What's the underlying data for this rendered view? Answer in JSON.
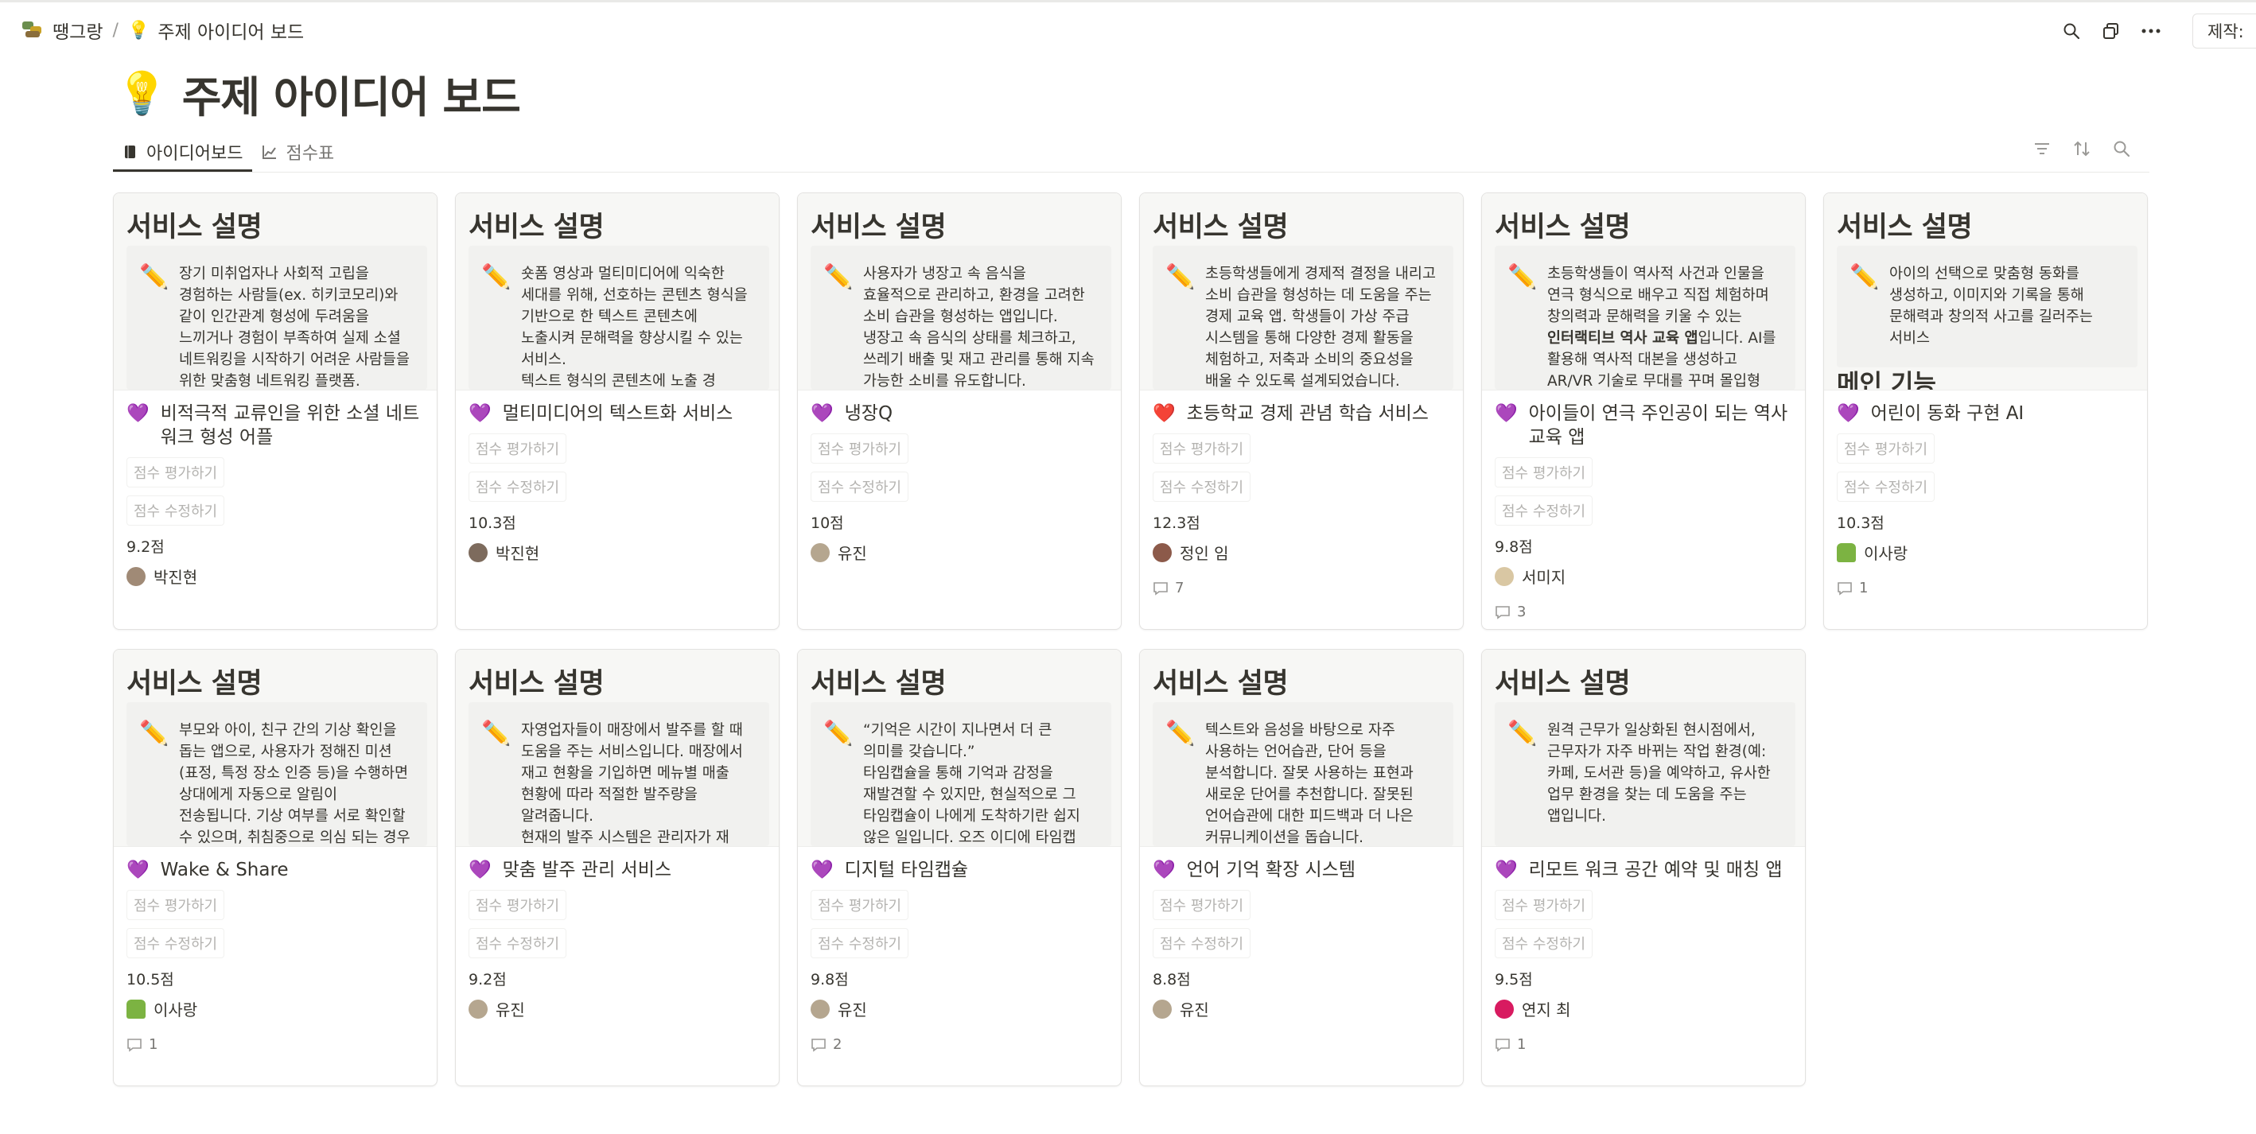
{
  "breadcrumb": {
    "workspace": "땡그랑",
    "separator": "/",
    "page_icon": "💡",
    "page": "주제 아이디어 보드"
  },
  "top_actions": {
    "search_icon": "search-icon",
    "duplicate_icon": "duplicate-icon",
    "more_icon": "more-icon",
    "made_by_label": "제작:"
  },
  "page": {
    "icon": "💡",
    "title": "주제 아이디어 보드"
  },
  "tabs": [
    {
      "label": "아이디어보드",
      "icon": "book-icon",
      "active": true
    },
    {
      "label": "점수표",
      "icon": "chart-icon",
      "active": false
    }
  ],
  "view_tools": [
    "filter-icon",
    "sort-icon",
    "search-icon"
  ],
  "cards": [
    {
      "cover_heading": "서비스 설명",
      "callout": "장기 미취업자나 사회적 고립을 경험하는 사람들(ex. 히키코모리)와 같이 인간관계 형성에 두려움을 느끼거나 경험이 부족하여 실제 소셜 네트워킹을 시작하기 어려운 사람들을 위한 맞춤형 네트워킹 플랫폼.",
      "title": "비적극적 교류인을 위한 소셜 네트워크 형성 어플",
      "heart": "💜",
      "rate_btn": "점수 평가하기",
      "edit_btn": "점수 수정하기",
      "score": "9.2점",
      "person": "박진현",
      "comments": ""
    },
    {
      "cover_heading": "서비스 설명",
      "callout": "숏폼 영상과 멀티미디어에 익숙한 세대를 위해, 선호하는 콘텐츠 형식을 기반으로 한 텍스트 콘텐츠에 노출시켜 문해력을 향상시킬 수 있는 서비스.\n텍스트 형식의 콘텐츠에 노출 경",
      "title": "멀티미디어의 텍스트화 서비스",
      "heart": "💜",
      "rate_btn": "점수 평가하기",
      "edit_btn": "점수 수정하기",
      "score": "10.3점",
      "person": "박진현",
      "comments": ""
    },
    {
      "cover_heading": "서비스 설명",
      "callout": "사용자가 냉장고 속 음식을 효율적으로 관리하고, 환경을 고려한 소비 습관을 형성하는 앱입니다. 냉장고 속 음식의 상태를 체크하고, 쓰레기 배출 및 재고 관리를 통해 지속 가능한 소비를 유도합니다.",
      "title": "냉장Q",
      "heart": "💜",
      "rate_btn": "점수 평가하기",
      "edit_btn": "점수 수정하기",
      "score": "10점",
      "person": "유진",
      "comments": ""
    },
    {
      "cover_heading": "서비스 설명",
      "callout": "초등학생들에게 경제적 결정을 내리고 소비 습관을 형성하는 데 도움을 주는 경제 교육 앱. 학생들이 가상 주급 시스템을 통해 다양한 경제 활동을 체험하고, 저축과 소비의 중요성을 배울 수 있도록 설계되었습니다.",
      "title": "초등학교 경제 관념 학습 서비스",
      "heart": "❤️",
      "rate_btn": "점수 평가하기",
      "edit_btn": "점수 수정하기",
      "score": "12.3점",
      "person": "정인 임",
      "comments": "7"
    },
    {
      "cover_heading": "서비스 설명",
      "callout_pre": "초등학생들이 역사적 사건과 인물을 연극 형식으로 배우고 직접 체험하며 창의력과 문해력을 키울 수 있는 ",
      "callout_bold": "인터랙티브 역사 교육 앱",
      "callout_post": "입니다. AI를 활용해 역사적 대본을 생성하고 AR/VR 기술로 무대를 꾸며 몰입형",
      "title": "아이들이 연극 주인공이 되는 역사 교육 앱",
      "heart": "💜",
      "rate_btn": "점수 평가하기",
      "edit_btn": "점수 수정하기",
      "score": "9.8점",
      "person": "서미지",
      "comments": "3"
    },
    {
      "cover_heading": "서비스 설명",
      "callout": "아이의 선택으로 맞춤형 동화를 생성하고, 이미지와 기록을 통해 문해력과 창의적 사고를 길러주는 서비스",
      "cover_extra": "메인 기능",
      "title": "어린이 동화 구현 AI",
      "heart": "💜",
      "rate_btn": "점수 평가하기",
      "edit_btn": "점수 수정하기",
      "score": "10.3점",
      "person": "이사랑",
      "comments": "1"
    },
    {
      "cover_heading": "서비스 설명",
      "callout": "부모와 아이, 친구 간의 기상 확인을 돕는 앱으로, 사용자가 정해진 미션(표정, 특정 장소 인증 등)을 수행하면 상대에게 자동으로 알림이 전송됩니다. 기상 여부를 서로 확인할 수 있으며, 취침중으로 의심 되는 경우",
      "title": "Wake & Share",
      "heart": "💜",
      "rate_btn": "점수 평가하기",
      "edit_btn": "점수 수정하기",
      "score": "10.5점",
      "person": "이사랑",
      "comments": "1"
    },
    {
      "cover_heading": "서비스 설명",
      "callout": "자영업자들이 매장에서 발주를 할 때 도움을 주는 서비스입니다. 매장에서 재고 현황을 기입하면 메뉴별 매출 현황에 따라 적절한 발주량을 알려줍니다.\n현재의 발주 시스템은 관리자가 재",
      "title": "맞춤 발주 관리 서비스",
      "heart": "💜",
      "rate_btn": "점수 평가하기",
      "edit_btn": "점수 수정하기",
      "score": "9.2점",
      "person": "유진",
      "comments": ""
    },
    {
      "cover_heading": "서비스 설명",
      "callout": "“기억은 시간이 지나면서 더 큰 의미를 갖습니다.”\n타임캡슐을 통해 기억과 감정을 재발견할 수 있지만, 현실적으로 그 타임캡슐이 나에게 도착하기란 쉽지 않은 일입니다. 오즈 이디에 타임캡",
      "title": "디지털 타임캡슐",
      "heart": "💜",
      "rate_btn": "점수 평가하기",
      "edit_btn": "점수 수정하기",
      "score": "9.8점",
      "person": "유진",
      "comments": "2"
    },
    {
      "cover_heading": "서비스 설명",
      "callout": "텍스트와 음성을 바탕으로 자주 사용하는 언어습관, 단어 등을 분석합니다. 잘못 사용하는 표현과 새로운 단어를 추천합니다. 잘못된 언어습관에 대한 피드백과 더 나은 커뮤니케이션을 돕습니다.",
      "title": "언어 기억 확장 시스템",
      "heart": "💜",
      "rate_btn": "점수 평가하기",
      "edit_btn": "점수 수정하기",
      "score": "8.8점",
      "person": "유진",
      "comments": ""
    },
    {
      "cover_heading": "서비스 설명",
      "callout": "원격 근무가 일상화된 현시점에서, 근무자가 자주 바뀌는 작업 환경(예: 카페, 도서관 등)을 예약하고, 유사한 업무 환경을 찾는 데 도움을 주는 앱입니다.",
      "title": "리모트 워크 공간 예약 및 매칭 앱",
      "heart": "💜",
      "rate_btn": "점수 평가하기",
      "edit_btn": "점수 수정하기",
      "score": "9.5점",
      "person": "연지 최",
      "comments": "1"
    }
  ]
}
